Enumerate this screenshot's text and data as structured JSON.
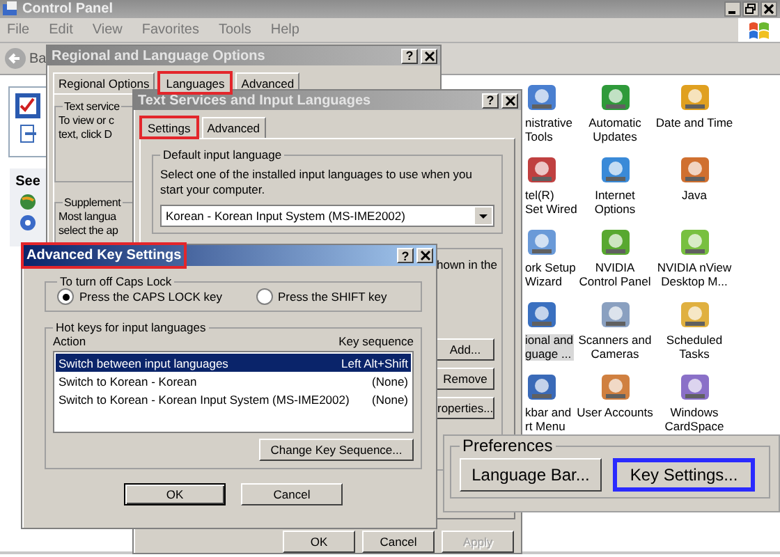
{
  "control_panel": {
    "title": "Control Panel",
    "menu": [
      "File",
      "Edit",
      "View",
      "Favorites",
      "Tools",
      "Help"
    ],
    "back_button": "Ba",
    "side_heading": "See",
    "applets": [
      {
        "lines": [
          "nistrative",
          "Tools"
        ],
        "selected": false
      },
      {
        "lines": [
          "Automatic",
          "Updates"
        ],
        "selected": false
      },
      {
        "lines": [
          "Date and Time"
        ],
        "selected": false
      },
      {
        "lines": [
          "tel(R)",
          "Set Wired"
        ],
        "selected": false
      },
      {
        "lines": [
          "Internet",
          "Options"
        ],
        "selected": false
      },
      {
        "lines": [
          "Java"
        ],
        "selected": false
      },
      {
        "lines": [
          "ork Setup",
          "Wizard"
        ],
        "selected": false
      },
      {
        "lines": [
          "NVIDIA",
          "Control Panel"
        ],
        "selected": false
      },
      {
        "lines": [
          "NVIDIA nView",
          "Desktop M..."
        ],
        "selected": false
      },
      {
        "lines": [
          "ional and",
          "guage ..."
        ],
        "selected": true
      },
      {
        "lines": [
          "Scanners and",
          "Cameras"
        ],
        "selected": false
      },
      {
        "lines": [
          "Scheduled",
          "Tasks"
        ],
        "selected": false
      },
      {
        "lines": [
          "kbar and",
          "rt Menu"
        ],
        "selected": false
      },
      {
        "lines": [
          "User Accounts"
        ],
        "selected": false
      },
      {
        "lines": [
          "Windows",
          "CardSpace"
        ],
        "selected": false
      }
    ]
  },
  "regional_dialog": {
    "title": "Regional and Language Options",
    "help_button": "?",
    "tabs": [
      {
        "label": "Regional Options",
        "selected": false,
        "highlighted": false
      },
      {
        "label": "Languages",
        "selected": true,
        "highlighted": true
      },
      {
        "label": "Advanced",
        "selected": false,
        "highlighted": false
      }
    ],
    "groups": [
      {
        "title": "Text service",
        "lines": [
          "To view or c",
          "text, click D"
        ]
      },
      {
        "title": "Supplement",
        "lines": [
          "Most langua",
          "select the ap"
        ]
      }
    ]
  },
  "text_services_dialog": {
    "title": "Text Services and Input Languages",
    "help_button": "?",
    "tabs": [
      {
        "label": "Settings",
        "selected": true,
        "highlighted": true
      },
      {
        "label": "Advanced",
        "selected": false,
        "highlighted": false
      }
    ],
    "default_language": {
      "title": "Default input language",
      "description": "Select one of the installed input languages to use when you start your computer.",
      "value": "Korean - Korean Input System (MS-IME2002)"
    },
    "installed_text": "hown in the",
    "side_buttons": [
      "Add...",
      "Remove",
      "roperties..."
    ],
    "buttons": [
      {
        "label": "OK",
        "disabled": false
      },
      {
        "label": "Cancel",
        "disabled": false
      },
      {
        "label": "Apply",
        "disabled": true
      }
    ]
  },
  "advanced_key_settings": {
    "title": "Advanced Key Settings",
    "title_highlighted": true,
    "help_button": "?",
    "caps_lock": {
      "title": "To turn off Caps Lock",
      "options": [
        {
          "label": "Press the CAPS LOCK key",
          "selected": true
        },
        {
          "label": "Press the SHIFT key",
          "selected": false
        }
      ]
    },
    "hot_keys": {
      "title": "Hot keys for input languages",
      "columns": [
        "Action",
        "Key sequence"
      ],
      "rows": [
        {
          "action": "Switch between input languages",
          "keys": "Left Alt+Shift",
          "selected": true
        },
        {
          "action": "Switch to Korean - Korean",
          "keys": "(None)",
          "selected": false
        },
        {
          "action": "Switch to Korean - Korean Input System (MS-IME2002)",
          "keys": "(None)",
          "selected": false
        }
      ]
    },
    "change_button": "Change Key Sequence...",
    "buttons": [
      "OK",
      "Cancel"
    ]
  },
  "preferences_inset": {
    "title": "Preferences",
    "buttons": [
      {
        "label": "Language Bar...",
        "highlighted": false
      },
      {
        "label": "Key Settings...",
        "highlighted": true
      }
    ]
  }
}
